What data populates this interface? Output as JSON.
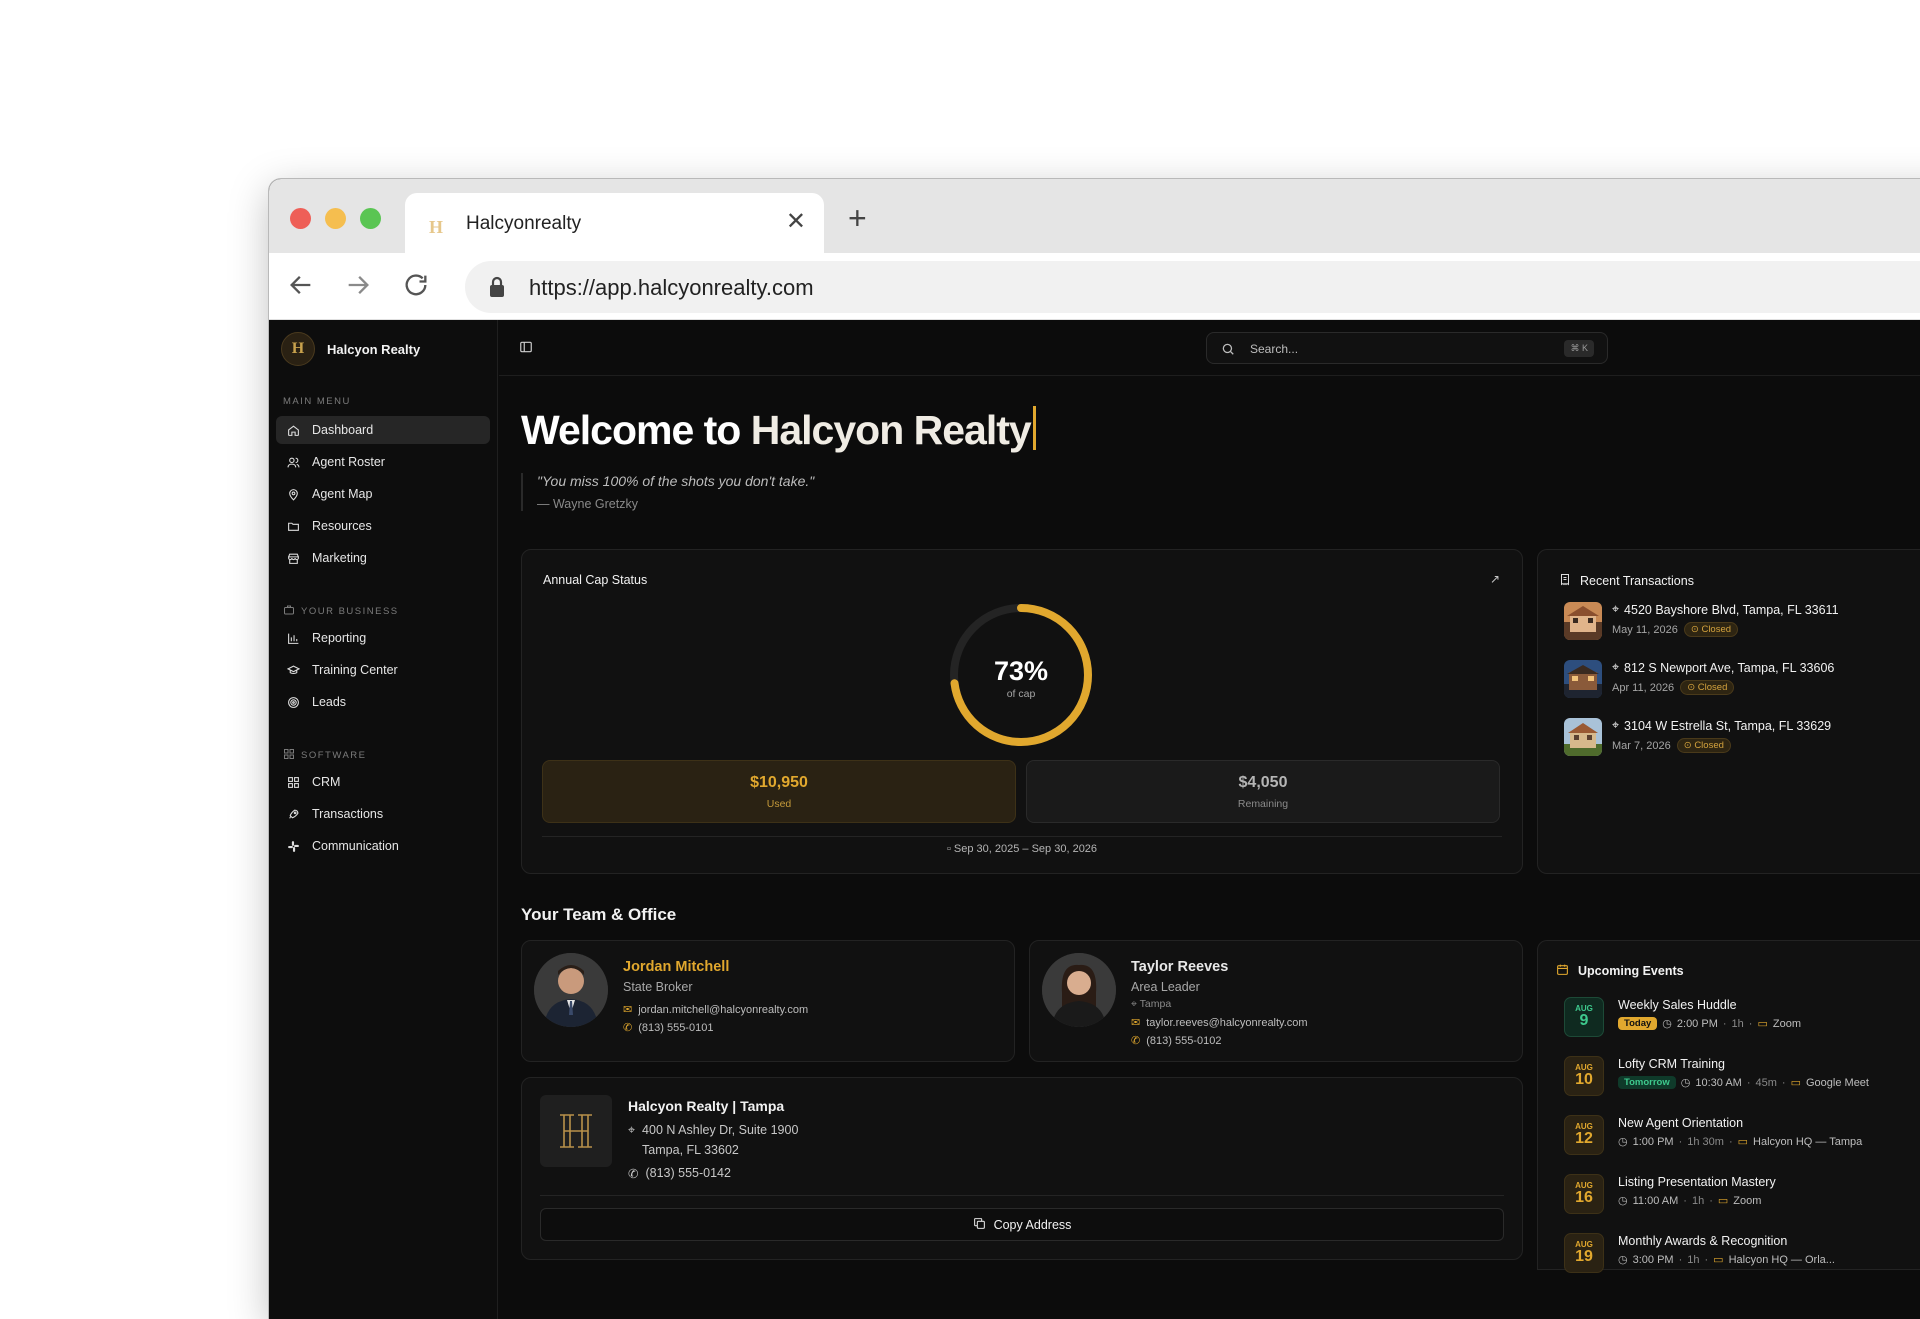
{
  "browser": {
    "tab_title": "Halcyonrealty",
    "url": "https://app.halcyonrealty.com"
  },
  "sidebar": {
    "brand": "Halcyon Realty",
    "sections": {
      "main": "MAIN MENU",
      "business": "YOUR BUSINESS",
      "software": "SOFTWARE"
    },
    "main_items": [
      "Dashboard",
      "Agent Roster",
      "Agent Map",
      "Resources",
      "Marketing"
    ],
    "business_items": [
      "Reporting",
      "Training Center",
      "Leads"
    ],
    "software_items": [
      "CRM",
      "Transactions",
      "Communication"
    ]
  },
  "topbar": {
    "search_placeholder": "Search...",
    "shortcut": "⌘ K"
  },
  "welcome": {
    "prefix": "Welcome to ",
    "brand": "Halcyon Realty"
  },
  "quote": {
    "text": "\"You miss 100% of the shots you don't take.\"",
    "author": "— Wayne Gretzky"
  },
  "cap": {
    "title": "Annual Cap Status",
    "percent_value": 0.73,
    "percent_label": "73%",
    "sub_label": "of cap",
    "used_value": "$10,950",
    "used_label": "Used",
    "remaining_value": "$4,050",
    "remaining_label": "Remaining",
    "range": "Sep 30, 2025 – Sep 30, 2026",
    "accent": "#e1a82e"
  },
  "transactions": {
    "title": "Recent Transactions",
    "items": [
      {
        "address": "4520 Bayshore Blvd, Tampa, FL 33611",
        "date": "May 11, 2026",
        "status": "Closed"
      },
      {
        "address": "812 S Newport Ave, Tampa, FL 33606",
        "date": "Apr 11, 2026",
        "status": "Closed"
      },
      {
        "address": "3104 W Estrella St, Tampa, FL 33629",
        "date": "Mar 7, 2026",
        "status": "Closed"
      }
    ]
  },
  "team": {
    "title": "Your Team & Office",
    "people": [
      {
        "name": "Jordan Mitchell",
        "role": "State Broker",
        "email": "jordan.mitchell@halcyonrealty.com",
        "phone": "(813) 555-0101"
      },
      {
        "name": "Taylor Reeves",
        "role": "Area Leader",
        "location": "Tampa",
        "email": "taylor.reeves@halcyonrealty.com",
        "phone": "(813) 555-0102"
      }
    ],
    "office": {
      "name": "Halcyon Realty | Tampa",
      "address_line1": "400 N Ashley Dr, Suite 1900",
      "address_line2": "Tampa, FL 33602",
      "phone": "(813) 555-0142",
      "copy_label": "Copy Address"
    }
  },
  "events": {
    "title": "Upcoming Events",
    "items": [
      {
        "month": "AUG",
        "day": "9",
        "name": "Weekly Sales Huddle",
        "tag": "Today",
        "time": "2:00 PM",
        "duration": "1h",
        "location": "Zoom"
      },
      {
        "month": "AUG",
        "day": "10",
        "name": "Lofty CRM Training",
        "tag": "Tomorrow",
        "time": "10:30 AM",
        "duration": "45m",
        "location": "Google Meet"
      },
      {
        "month": "AUG",
        "day": "12",
        "name": "New Agent Orientation",
        "tag": "",
        "time": "1:00 PM",
        "duration": "1h 30m",
        "location": "Halcyon HQ — Tampa"
      },
      {
        "month": "AUG",
        "day": "16",
        "name": "Listing Presentation Mastery",
        "tag": "",
        "time": "11:00 AM",
        "duration": "1h",
        "location": "Zoom"
      },
      {
        "month": "AUG",
        "day": "19",
        "name": "Monthly Awards & Recognition",
        "tag": "",
        "time": "3:00 PM",
        "duration": "1h",
        "location": "Halcyon HQ — Orla..."
      }
    ]
  }
}
